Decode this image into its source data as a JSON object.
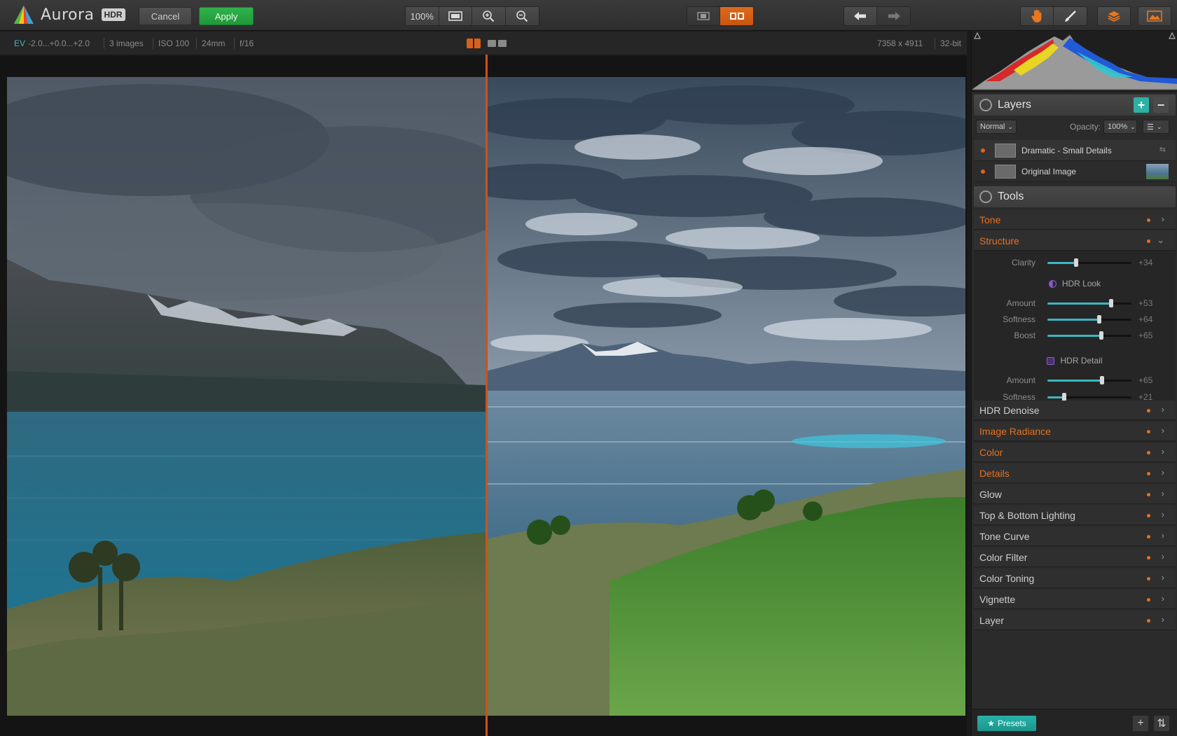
{
  "app": {
    "name": "Aurora",
    "badge": "HDR"
  },
  "toolbar": {
    "cancel_label": "Cancel",
    "apply_label": "Apply",
    "zoom_value": "100%"
  },
  "info_bar": {
    "ev_label": "EV",
    "ev_values": "-2.0...+0.0...+2.0",
    "images": "3 images",
    "iso": "ISO 100",
    "focal": "24mm",
    "aperture": "f/16",
    "dimensions": "7358 x 4911",
    "bitdepth": "32-bit"
  },
  "layers": {
    "title": "Layers",
    "blend_mode": "Normal",
    "opacity_label": "Opacity:",
    "opacity_value": "100%",
    "items": [
      {
        "name": "Dramatic - Small Details"
      },
      {
        "name": "Original Image"
      }
    ]
  },
  "tools": {
    "title": "Tools",
    "tone": "Tone",
    "structure": "Structure",
    "clarity": {
      "label": "Clarity",
      "value": "+34",
      "level": 0.34
    },
    "hdr_look": {
      "title": "HDR Look",
      "amount": {
        "label": "Amount",
        "value": "+53",
        "level": 0.76
      },
      "softness": {
        "label": "Softness",
        "value": "+64",
        "level": 0.62
      },
      "boost": {
        "label": "Boost",
        "value": "+65",
        "level": 0.64
      }
    },
    "hdr_detail": {
      "title": "HDR Detail",
      "amount": {
        "label": "Amount",
        "value": "+65",
        "level": 0.65
      },
      "softness": {
        "label": "Softness",
        "value": "+21",
        "level": 0.2
      }
    },
    "items": [
      {
        "label": "HDR Denoise",
        "active": false
      },
      {
        "label": "Image Radiance",
        "active": true
      },
      {
        "label": "Color",
        "active": true
      },
      {
        "label": "Details",
        "active": true
      },
      {
        "label": "Glow",
        "active": false
      },
      {
        "label": "Top & Bottom Lighting",
        "active": false
      },
      {
        "label": "Tone Curve",
        "active": false
      },
      {
        "label": "Color Filter",
        "active": false
      },
      {
        "label": "Color Toning",
        "active": false
      },
      {
        "label": "Vignette",
        "active": false
      },
      {
        "label": "Layer",
        "active": false
      }
    ]
  },
  "footer": {
    "presets_label": "Presets"
  },
  "colors": {
    "accent": "#e5711f",
    "apply": "#27a843",
    "teal": "#27b2a8"
  },
  "icons": [
    "hand-icon",
    "brush-icon",
    "layers-stack-icon",
    "image-panel-icon",
    "undo-icon",
    "redo-icon",
    "zoom-in-icon",
    "zoom-out-icon",
    "fit-screen-icon"
  ]
}
